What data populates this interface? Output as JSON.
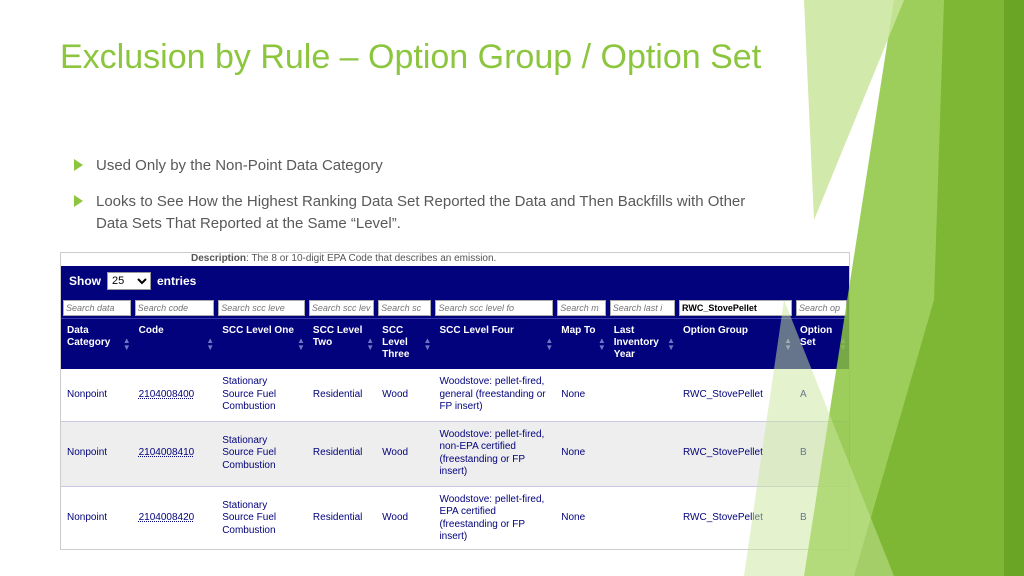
{
  "title": "Exclusion by Rule – Option Group / Option Set",
  "bullets": [
    "Used Only by the Non-Point Data Category",
    "Looks to See How the Highest Ranking Data Set Reported the Data and Then Backfills with Other Data Sets That Reported at the Same “Level”."
  ],
  "description": {
    "label": "Description",
    "text": ": The 8 or 10-digit EPA Code that describes an emission."
  },
  "pager": {
    "show": "Show",
    "value": "25",
    "entries": "entries"
  },
  "filters": {
    "placeholders": [
      "Search data",
      "Search code",
      "Search scc leve",
      "Search scc lev",
      "Search sc",
      "Search scc level fo",
      "Search m",
      "Search last i",
      "",
      "Search op"
    ],
    "values": [
      "",
      "",
      "",
      "",
      "",
      "",
      "",
      "",
      "RWC_StovePellet",
      ""
    ]
  },
  "headers": [
    "Data Category",
    "Code",
    "SCC Level One",
    "SCC Level Two",
    "SCC Level Three",
    "SCC Level Four",
    "Map To",
    "Last Inventory Year",
    "Option Group",
    "Option Set"
  ],
  "rows": [
    {
      "cat": "Nonpoint",
      "code": "2104008400",
      "l1": "Stationary Source Fuel Combustion",
      "l2": "Residential",
      "l3": "Wood",
      "l4": "Woodstove: pellet-fired, general (freestanding or FP insert)",
      "map": "None",
      "year": "",
      "og": "RWC_StovePellet",
      "os": "A"
    },
    {
      "cat": "Nonpoint",
      "code": "2104008410",
      "l1": "Stationary Source Fuel Combustion",
      "l2": "Residential",
      "l3": "Wood",
      "l4": "Woodstove: pellet-fired, non-EPA certified (freestanding or FP insert)",
      "map": "None",
      "year": "",
      "og": "RWC_StovePellet",
      "os": "B"
    },
    {
      "cat": "Nonpoint",
      "code": "2104008420",
      "l1": "Stationary Source Fuel Combustion",
      "l2": "Residential",
      "l3": "Wood",
      "l4": "Woodstove: pellet-fired, EPA certified (freestanding or FP insert)",
      "map": "None",
      "year": "",
      "og": "RWC_StovePellet",
      "os": "B"
    }
  ]
}
